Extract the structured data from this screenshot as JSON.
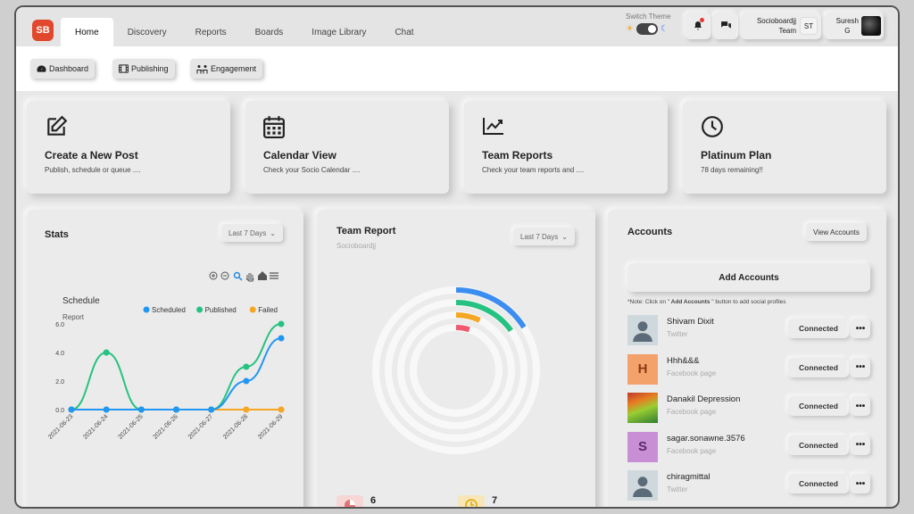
{
  "topbar": {
    "logo": "SB",
    "tabs": [
      {
        "label": "Home"
      },
      {
        "label": "Discovery"
      },
      {
        "label": "Reports"
      },
      {
        "label": "Boards"
      },
      {
        "label": "Image Library"
      },
      {
        "label": "Chat"
      }
    ],
    "switch_theme_label": "Switch Theme",
    "team_name_line1": "Socioboardjj",
    "team_name_line2": "Team",
    "team_initials": "ST",
    "user_line1": "Suresh",
    "user_line2": "G"
  },
  "subnav": {
    "items": [
      {
        "label": "Dashboard",
        "icon": "dashboard-icon"
      },
      {
        "label": "Publishing",
        "icon": "film-icon"
      },
      {
        "label": "Engagement",
        "icon": "people-icon"
      }
    ]
  },
  "quick_cards": [
    {
      "title": "Create a New Post",
      "subtitle": "Publish, schedule or queue ....",
      "icon": "edit-icon"
    },
    {
      "title": "Calendar View",
      "subtitle": "Check your Socio Calendar ....",
      "icon": "calendar-icon"
    },
    {
      "title": "Team Reports",
      "subtitle": "Check your team reports and ....",
      "icon": "chart-icon"
    },
    {
      "title": "Platinum Plan",
      "subtitle": "78 days remaining!!",
      "icon": "clock-icon"
    }
  ],
  "stats": {
    "title": "Stats",
    "range": "Last 7 Days"
  },
  "chart_data": {
    "type": "line",
    "title": "Schedule",
    "subtitle": "Report",
    "xlabel": "",
    "ylabel": "",
    "x": [
      "2021-06-23",
      "2021-06-24",
      "2021-06-25",
      "2021-06-26",
      "2021-06-27",
      "2021-06-28",
      "2021-06-29"
    ],
    "ylim": [
      0,
      6
    ],
    "yticks": [
      "0.0",
      "2.0",
      "4.0",
      "6.0"
    ],
    "legend": "top-right",
    "series": [
      {
        "name": "Scheduled",
        "color": "#2196f3",
        "values": [
          0,
          0,
          0,
          0,
          0,
          2,
          5
        ]
      },
      {
        "name": "Published",
        "color": "#26c281",
        "values": [
          0,
          4,
          0,
          0,
          0,
          3,
          6
        ]
      },
      {
        "name": "Failed",
        "color": "#f5a623",
        "values": [
          0,
          0,
          0,
          0,
          0,
          0,
          0
        ]
      }
    ]
  },
  "team_report": {
    "title": "Team Report",
    "subtitle": "Socioboardjj",
    "range": "Last 7 Days",
    "stat1": "6",
    "stat2": "7",
    "arc_colors": [
      "#3b8ef0",
      "#26c281",
      "#f5a623",
      "#ef5a6f"
    ],
    "arc_values": [
      0.16,
      0.15,
      0.07,
      0.05
    ]
  },
  "accounts": {
    "title": "Accounts",
    "view_label": "View Accounts",
    "add_label": "Add Accounts",
    "note_prefix": "*Note: Click on \"",
    "note_bold": " Add Accounts ",
    "note_suffix": "\" button to add social profiles",
    "connected_label": "Connected",
    "more_label": "•••",
    "items": [
      {
        "name": "Shivam Dixit",
        "type": "Twitter",
        "avatar": "",
        "bg": "#cfd8dc",
        "kind": "person"
      },
      {
        "name": "Hhh&&&",
        "type": "Facebook page",
        "avatar": "H",
        "bg": "#f4a26b",
        "kind": "letter"
      },
      {
        "name": "Danakil Depression",
        "type": "Facebook page",
        "avatar": "",
        "bg": "#7aa23a",
        "kind": "photo"
      },
      {
        "name": "sagar.sonawne.3576",
        "type": "Facebook page",
        "avatar": "S",
        "bg": "#c98fd6",
        "kind": "letter"
      },
      {
        "name": "chiragmittal",
        "type": "Twitter",
        "avatar": "",
        "bg": "#cfd8dc",
        "kind": "person"
      }
    ]
  }
}
